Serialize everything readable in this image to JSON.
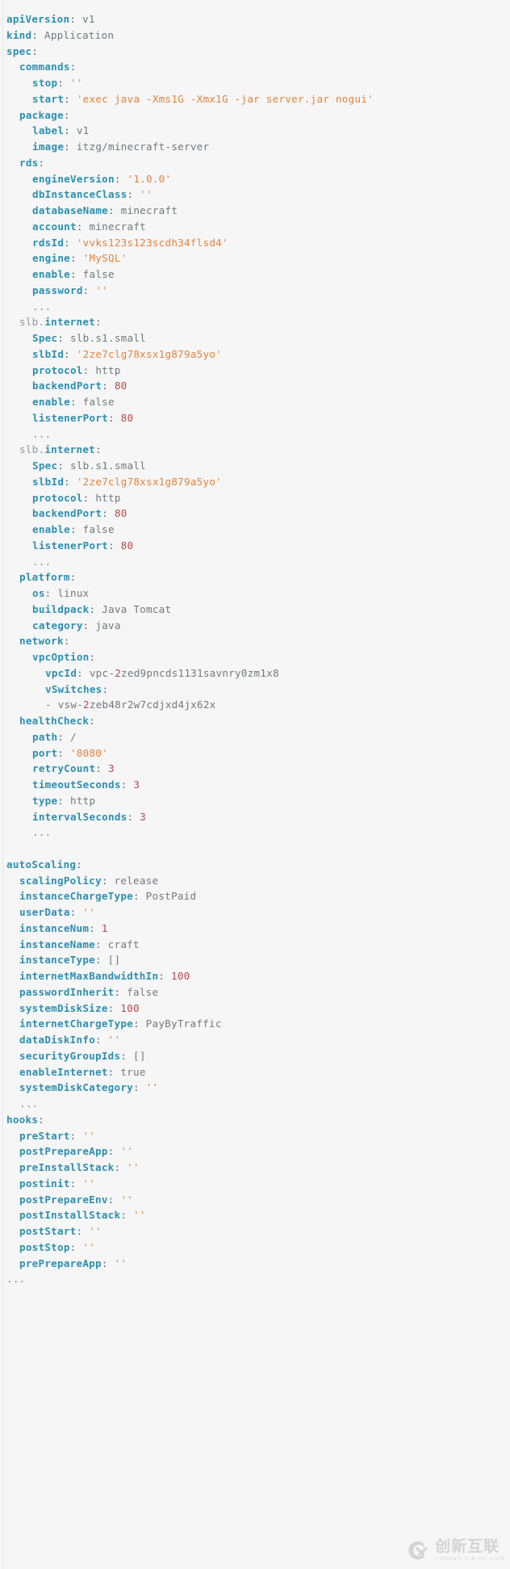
{
  "document": {
    "title": "Application spec (YAML)",
    "language": "yaml",
    "background_color": "#f6f6f6"
  },
  "theme": {
    "key_color": "#2d8fb0",
    "key_prefix_color": "#8a9a9e",
    "value_color": "#6f7a7d",
    "string_color": "#e0843e",
    "number_color": "#b5494b",
    "punctuation_color": "#5d6d72",
    "ellipsis_color": "#7f8c8d"
  },
  "watermark": {
    "logo": "cx-circle-logo",
    "chinese": "创新互联",
    "pinyin": "CHUANG XIN HU LIAN"
  },
  "lines": [
    {
      "indent": 0,
      "key": "apiVersion",
      "sep": ":",
      "value": "v1",
      "type": "plain"
    },
    {
      "indent": 0,
      "key": "kind",
      "sep": ":",
      "value": "Application",
      "type": "plain"
    },
    {
      "indent": 0,
      "key": "spec",
      "sep": ":",
      "value": "",
      "type": "map"
    },
    {
      "indent": 1,
      "key": "commands",
      "sep": ":",
      "value": "",
      "type": "map"
    },
    {
      "indent": 2,
      "key": "stop",
      "sep": ":",
      "value": "''",
      "type": "string"
    },
    {
      "indent": 2,
      "key": "start",
      "sep": ":",
      "value": "'exec java -Xms1G -Xmx1G -jar server.jar nogui'",
      "type": "string"
    },
    {
      "indent": 1,
      "key": "package",
      "sep": ":",
      "value": "",
      "type": "map"
    },
    {
      "indent": 2,
      "key": "label",
      "sep": ":",
      "value": "v1",
      "type": "plain"
    },
    {
      "indent": 2,
      "key": "image",
      "sep": ":",
      "value": "itzg/minecraft-server",
      "type": "plain"
    },
    {
      "indent": 1,
      "key": "rds",
      "sep": ":",
      "value": "",
      "type": "map"
    },
    {
      "indent": 2,
      "key": "engineVersion",
      "sep": ":",
      "value": "'1.0.0'",
      "type": "string"
    },
    {
      "indent": 2,
      "key": "dbInstanceClass",
      "sep": ":",
      "value": "''",
      "type": "string"
    },
    {
      "indent": 2,
      "key": "databaseName",
      "sep": ":",
      "value": "minecraft",
      "type": "plain"
    },
    {
      "indent": 2,
      "key": "account",
      "sep": ":",
      "value": "minecraft",
      "type": "plain"
    },
    {
      "indent": 2,
      "key": "rdsId",
      "sep": ":",
      "value": "'vvks123s123scdh34flsd4'",
      "type": "string"
    },
    {
      "indent": 2,
      "key": "engine",
      "sep": ":",
      "value": "'MySQL'",
      "type": "string"
    },
    {
      "indent": 2,
      "key": "enable",
      "sep": ":",
      "value": "false",
      "type": "bool"
    },
    {
      "indent": 2,
      "key": "password",
      "sep": ":",
      "value": "''",
      "type": "string"
    },
    {
      "indent": 2,
      "key": "",
      "sep": "",
      "value": "...",
      "type": "ellipsis"
    },
    {
      "indent": 1,
      "key_prefix": "slb.",
      "key": "internet",
      "sep": ":",
      "value": "",
      "type": "map"
    },
    {
      "indent": 2,
      "key": "Spec",
      "sep": ":",
      "value": "slb.s1.small",
      "type": "plain"
    },
    {
      "indent": 2,
      "key": "slbId",
      "sep": ":",
      "value": "'2ze7clg78xsx1g879a5yo'",
      "type": "string"
    },
    {
      "indent": 2,
      "key": "protocol",
      "sep": ":",
      "value": "http",
      "type": "plain"
    },
    {
      "indent": 2,
      "key": "backendPort",
      "sep": ":",
      "value": "80",
      "type": "number"
    },
    {
      "indent": 2,
      "key": "enable",
      "sep": ":",
      "value": "false",
      "type": "bool"
    },
    {
      "indent": 2,
      "key": "listenerPort",
      "sep": ":",
      "value": "80",
      "type": "number"
    },
    {
      "indent": 2,
      "key": "",
      "sep": "",
      "value": "...",
      "type": "ellipsis"
    },
    {
      "indent": 1,
      "key_prefix": "slb.",
      "key": "internet",
      "sep": ":",
      "value": "",
      "type": "map"
    },
    {
      "indent": 2,
      "key": "Spec",
      "sep": ":",
      "value": "slb.s1.small",
      "type": "plain"
    },
    {
      "indent": 2,
      "key": "slbId",
      "sep": ":",
      "value": "'2ze7clg78xsx1g879a5yo'",
      "type": "string"
    },
    {
      "indent": 2,
      "key": "protocol",
      "sep": ":",
      "value": "http",
      "type": "plain"
    },
    {
      "indent": 2,
      "key": "backendPort",
      "sep": ":",
      "value": "80",
      "type": "number"
    },
    {
      "indent": 2,
      "key": "enable",
      "sep": ":",
      "value": "false",
      "type": "bool"
    },
    {
      "indent": 2,
      "key": "listenerPort",
      "sep": ":",
      "value": "80",
      "type": "number"
    },
    {
      "indent": 2,
      "key": "",
      "sep": "",
      "value": "...",
      "type": "ellipsis"
    },
    {
      "indent": 1,
      "key": "platform",
      "sep": ":",
      "value": "",
      "type": "map"
    },
    {
      "indent": 2,
      "key": "os",
      "sep": ":",
      "value": "linux",
      "type": "plain"
    },
    {
      "indent": 2,
      "key": "buildpack",
      "sep": ":",
      "value": "Java Tomcat",
      "type": "plain"
    },
    {
      "indent": 2,
      "key": "category",
      "sep": ":",
      "value": "java",
      "type": "plain"
    },
    {
      "indent": 1,
      "key": "network",
      "sep": ":",
      "value": "",
      "type": "map"
    },
    {
      "indent": 2,
      "key": "vpcOption",
      "sep": ":",
      "value": "",
      "type": "map"
    },
    {
      "indent": 3,
      "key": "vpcId",
      "sep": ":",
      "value": "vpc-2zed9pncds1131savnry0zm1x8",
      "type": "plain_numlead",
      "lead": "vpc-",
      "digit": "2",
      "tail": "zed9pncds1131savnry0zm1x8"
    },
    {
      "indent": 3,
      "key": "vSwitches",
      "sep": ":",
      "value": "",
      "type": "map"
    },
    {
      "indent": 3,
      "key": "",
      "sep": "",
      "value": "- vsw-2zeb48r2w7cdjxd4jx62x",
      "type": "seq_numlead",
      "lead": "- vsw-",
      "digit": "2",
      "tail": "zeb48r2w7cdjxd4jx62x"
    },
    {
      "indent": 1,
      "key": "healthCheck",
      "sep": ":",
      "value": "",
      "type": "map"
    },
    {
      "indent": 2,
      "key": "path",
      "sep": ":",
      "value": "/",
      "type": "plain"
    },
    {
      "indent": 2,
      "key": "port",
      "sep": ":",
      "value": "'8080'",
      "type": "string"
    },
    {
      "indent": 2,
      "key": "retryCount",
      "sep": ":",
      "value": "3",
      "type": "number"
    },
    {
      "indent": 2,
      "key": "timeoutSeconds",
      "sep": ":",
      "value": "3",
      "type": "number"
    },
    {
      "indent": 2,
      "key": "type",
      "sep": ":",
      "value": "http",
      "type": "plain"
    },
    {
      "indent": 2,
      "key": "intervalSeconds",
      "sep": ":",
      "value": "3",
      "type": "number"
    },
    {
      "indent": 2,
      "key": "",
      "sep": "",
      "value": "...",
      "type": "ellipsis"
    },
    {
      "indent": -1,
      "key": "",
      "sep": "",
      "value": "",
      "type": "blank"
    },
    {
      "indent": 0,
      "key": "autoScaling",
      "sep": ":",
      "value": "",
      "type": "map"
    },
    {
      "indent": 1,
      "key": "scalingPolicy",
      "sep": ":",
      "value": "release",
      "type": "plain"
    },
    {
      "indent": 1,
      "key": "instanceChargeType",
      "sep": ":",
      "value": "PostPaid",
      "type": "plain"
    },
    {
      "indent": 1,
      "key": "userData",
      "sep": ":",
      "value": "''",
      "type": "string"
    },
    {
      "indent": 1,
      "key": "instanceNum",
      "sep": ":",
      "value": "1",
      "type": "number"
    },
    {
      "indent": 1,
      "key": "instanceName",
      "sep": ":",
      "value": "craft",
      "type": "plain"
    },
    {
      "indent": 1,
      "key": "instanceType",
      "sep": ":",
      "value": "[]",
      "type": "bracket"
    },
    {
      "indent": 1,
      "key": "internetMaxBandwidthIn",
      "sep": ":",
      "value": "100",
      "type": "number"
    },
    {
      "indent": 1,
      "key": "passwordInherit",
      "sep": ":",
      "value": "false",
      "type": "bool"
    },
    {
      "indent": 1,
      "key": "systemDiskSize",
      "sep": ":",
      "value": "100",
      "type": "number"
    },
    {
      "indent": 1,
      "key": "internetChargeType",
      "sep": ":",
      "value": "PayByTraffic",
      "type": "plain"
    },
    {
      "indent": 1,
      "key": "dataDiskInfo",
      "sep": ":",
      "value": "''",
      "type": "string"
    },
    {
      "indent": 1,
      "key": "securityGroupIds",
      "sep": ":",
      "value": "[]",
      "type": "bracket"
    },
    {
      "indent": 1,
      "key": "enableInternet",
      "sep": ":",
      "value": "true",
      "type": "bool"
    },
    {
      "indent": 1,
      "key": "systemDiskCategory",
      "sep": ":",
      "value": "''",
      "type": "string"
    },
    {
      "indent": 1,
      "key": "",
      "sep": "",
      "value": "...",
      "type": "ellipsis"
    },
    {
      "indent": 0,
      "key": "hooks",
      "sep": ":",
      "value": "",
      "type": "map"
    },
    {
      "indent": 1,
      "key": "preStart",
      "sep": ":",
      "value": "''",
      "type": "string"
    },
    {
      "indent": 1,
      "key": "postPrepareApp",
      "sep": ":",
      "value": "''",
      "type": "string"
    },
    {
      "indent": 1,
      "key": "preInstallStack",
      "sep": ":",
      "value": "''",
      "type": "string"
    },
    {
      "indent": 1,
      "key": "postinit",
      "sep": ":",
      "value": "''",
      "type": "string"
    },
    {
      "indent": 1,
      "key": "postPrepareEnv",
      "sep": ":",
      "value": "''",
      "type": "string"
    },
    {
      "indent": 1,
      "key": "postInstallStack",
      "sep": ":",
      "value": "''",
      "type": "string"
    },
    {
      "indent": 1,
      "key": "postStart",
      "sep": ":",
      "value": "''",
      "type": "string"
    },
    {
      "indent": 1,
      "key": "postStop",
      "sep": ":",
      "value": "''",
      "type": "string"
    },
    {
      "indent": 1,
      "key": "prePrepareApp",
      "sep": ":",
      "value": "''",
      "type": "string"
    },
    {
      "indent": 0,
      "key": "",
      "sep": "",
      "value": "...",
      "type": "ellipsis"
    }
  ]
}
